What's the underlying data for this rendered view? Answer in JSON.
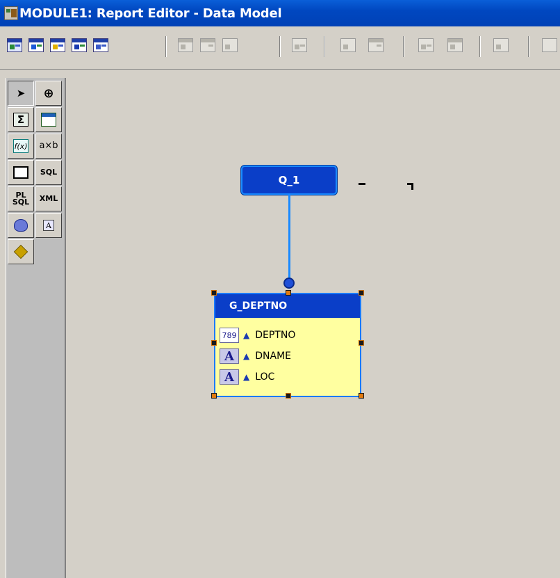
{
  "window": {
    "title": "MODULE1: Report Editor - Data Model"
  },
  "toolbar": {
    "buttons": [
      {
        "icon": "data-model-view-icon",
        "state": "active"
      },
      {
        "icon": "web-source-view-icon",
        "state": "enabled"
      },
      {
        "icon": "paper-layout-view-icon",
        "state": "enabled"
      },
      {
        "icon": "paper-design-view-icon",
        "state": "enabled"
      },
      {
        "icon": "paper-parameter-form-view-icon",
        "state": "enabled"
      },
      {
        "icon": "align-left-icon",
        "state": "disabled"
      },
      {
        "icon": "align-center-icon",
        "state": "disabled"
      },
      {
        "icon": "align-right-icon",
        "state": "disabled"
      },
      {
        "icon": "bring-to-front-icon",
        "state": "disabled"
      },
      {
        "icon": "group-icon",
        "state": "disabled"
      },
      {
        "icon": "ungroup-icon",
        "state": "disabled"
      },
      {
        "icon": "size-objects-icon",
        "state": "disabled"
      },
      {
        "icon": "align-objects-icon",
        "state": "disabled"
      },
      {
        "icon": "distribute-icon",
        "state": "disabled"
      },
      {
        "icon": "more-icon",
        "state": "disabled"
      }
    ]
  },
  "palette": {
    "tools": [
      {
        "name": "select-tool",
        "icon": "arrow-pointer-icon",
        "label": ""
      },
      {
        "name": "magnify-tool",
        "icon": "magnify-icon",
        "label": ""
      },
      {
        "name": "summary-column-tool",
        "icon": "sigma-icon",
        "label": "Σ"
      },
      {
        "name": "cross-product-tool",
        "icon": "cross-product-icon",
        "label": ""
      },
      {
        "name": "formula-column-tool",
        "icon": "formula-icon",
        "label": "f(x)"
      },
      {
        "name": "placeholder-column-tool",
        "icon": "placeholder-icon",
        "label": "a×b"
      },
      {
        "name": "data-link-tool",
        "icon": "data-link-icon",
        "label": ""
      },
      {
        "name": "sql-query-tool",
        "icon": "sql-query-icon",
        "label": "SQL"
      },
      {
        "name": "ref-cursor-query-tool",
        "icon": "plsql-query-icon",
        "label": "PL SQL"
      },
      {
        "name": "xml-query-tool",
        "icon": "xml-query-icon",
        "label": "XML"
      },
      {
        "name": "express-query-tool",
        "icon": "express-query-icon",
        "label": ""
      },
      {
        "name": "text-query-tool",
        "icon": "text-query-icon",
        "label": "A"
      },
      {
        "name": "jdbc-query-tool",
        "icon": "jdbc-query-icon",
        "label": ""
      }
    ]
  },
  "canvas": {
    "query": {
      "label": "Q_1"
    },
    "group": {
      "title": "G_DEPTNO",
      "columns": [
        {
          "name": "DEPTNO",
          "type_label": "789",
          "type": "number",
          "arrow": "▲"
        },
        {
          "name": "DNAME",
          "type_label": "A",
          "type": "character",
          "arrow": "▲"
        },
        {
          "name": "LOC",
          "type_label": "A",
          "type": "character",
          "arrow": "▲"
        }
      ]
    }
  },
  "colors": {
    "title_bar": "#0047c0",
    "canvas_bg": "#d4d0c8",
    "node_blue": "#0a3ec8",
    "link_blue": "#1a8aff",
    "group_body": "#ffffa0"
  }
}
